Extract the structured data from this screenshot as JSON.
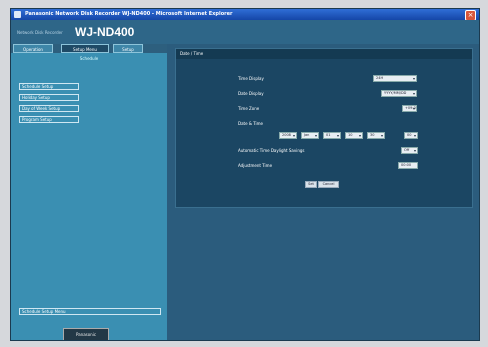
{
  "window": {
    "title": "Panasonic Network Disk Recorder WJ-ND400 - Microsoft Internet Explorer"
  },
  "brand": {
    "subtitle": "Network Disk Recorder",
    "model": "WJ-ND400"
  },
  "tabs": [
    "Operation",
    "Setup Menu",
    "Setup"
  ],
  "sidebar": {
    "heading": "Schedule",
    "items": [
      "Schedule Setup",
      "Holiday Setup",
      "Day of Week Setup",
      "Program Setup"
    ],
    "bottom_item": "Schedule Setup Menu",
    "logo": "Panasonic"
  },
  "panel": {
    "title": "Date / Time",
    "rows": [
      {
        "label": "Time Display",
        "value": "24H"
      },
      {
        "label": "Date Display",
        "value": "YYYY/MM/DD"
      },
      {
        "label": "Time Zone",
        "value": "+09:00"
      },
      {
        "label": "Date & Time",
        "value": ""
      },
      {
        "label": "Automatic Time Daylight Savings",
        "value": "Off"
      },
      {
        "label": "Adjustment Time",
        "value": "00:00"
      }
    ],
    "datetime_fields": [
      "2008",
      "Jan",
      "01",
      "10",
      "30",
      "00"
    ],
    "buttons": {
      "set": "Set",
      "cancel": "Cancel"
    }
  }
}
